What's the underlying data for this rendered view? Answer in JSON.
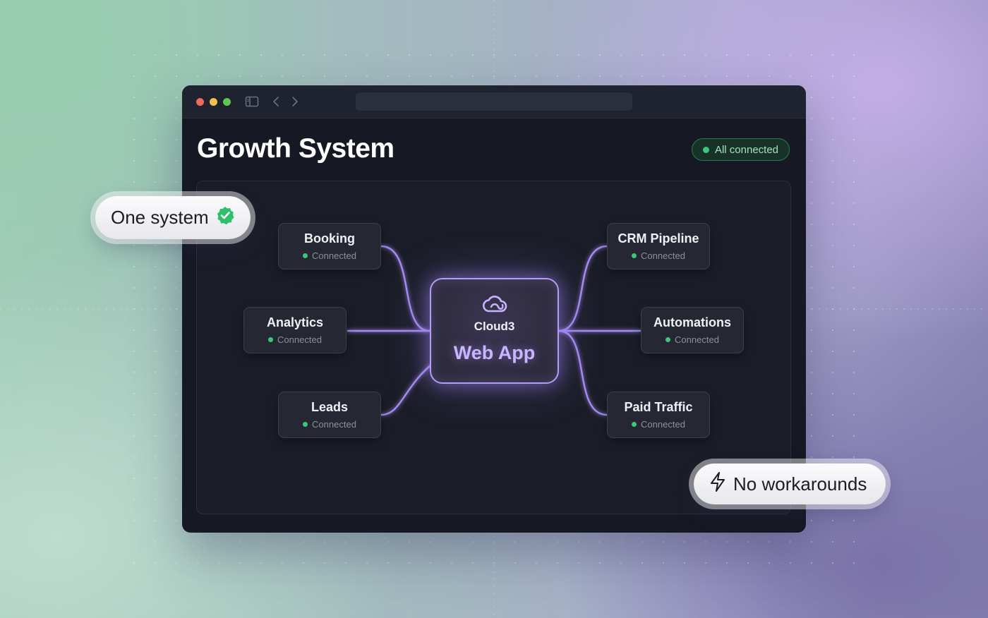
{
  "window": {
    "page_title": "Growth System",
    "status_badge": "All connected"
  },
  "hub": {
    "brand": "Cloud3",
    "app": "Web App",
    "icon": "cloud-icon"
  },
  "nodes": [
    {
      "title": "Booking",
      "status": "Connected"
    },
    {
      "title": "Analytics",
      "status": "Connected"
    },
    {
      "title": "Leads",
      "status": "Connected"
    },
    {
      "title": "CRM Pipeline",
      "status": "Connected"
    },
    {
      "title": "Automations",
      "status": "Connected"
    },
    {
      "title": "Paid Traffic",
      "status": "Connected"
    }
  ],
  "badges": {
    "one_system": "One system",
    "no_workarounds": "No workarounds"
  },
  "colors": {
    "accent": "#b59cf5",
    "connected": "#3ec77a",
    "window_bg": "#161923"
  }
}
